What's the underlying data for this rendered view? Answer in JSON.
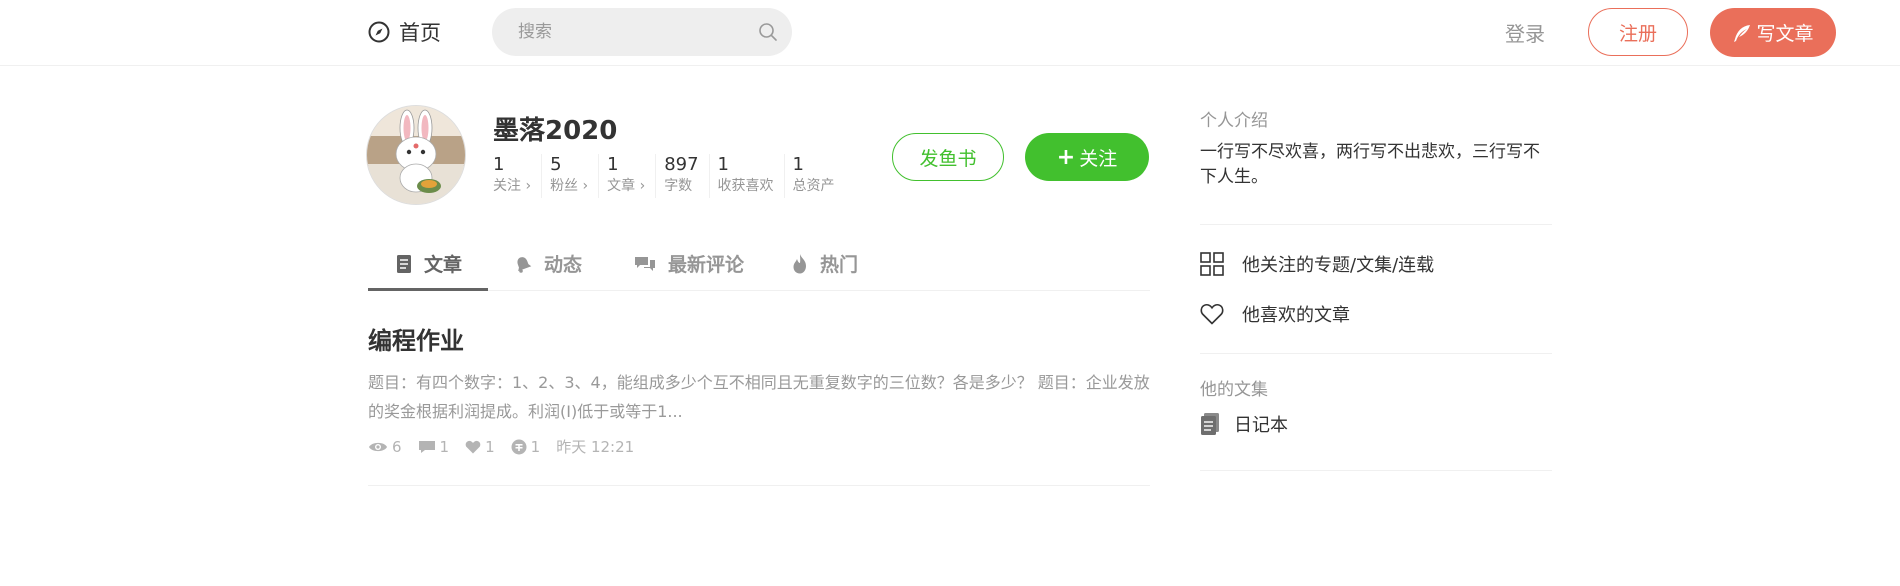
{
  "header": {
    "home_label": "首页",
    "search_placeholder": "搜索",
    "login_label": "登录",
    "register_label": "注册",
    "write_label": "写文章"
  },
  "profile": {
    "username": "墨落2020",
    "stats": [
      {
        "num": "1",
        "label": "关注 ›"
      },
      {
        "num": "5",
        "label": "粉丝 ›"
      },
      {
        "num": "1",
        "label": "文章 ›"
      },
      {
        "num": "897",
        "label": "字数"
      },
      {
        "num": "1",
        "label": "收获喜欢"
      },
      {
        "num": "1",
        "label": "总资产"
      }
    ],
    "fish_label": "发鱼书",
    "follow_label": "关注"
  },
  "tabs": [
    {
      "label": "文章",
      "icon": "article-icon",
      "active": true
    },
    {
      "label": "动态",
      "icon": "bell-icon",
      "active": false
    },
    {
      "label": "最新评论",
      "icon": "comments-icon",
      "active": false
    },
    {
      "label": "热门",
      "icon": "fire-icon",
      "active": false
    }
  ],
  "article": {
    "title": "编程作业",
    "abstract": "题目：有四个数字：1、2、3、4，能组成多少个互不相同且无重复数字的三位数？各是多少？ 题目：企业发放的奖金根据利润提成。利润(I)低于或等于1...",
    "views": "6",
    "comments": "1",
    "likes": "1",
    "rewards": "1",
    "time": "昨天 12:21"
  },
  "sidebar": {
    "intro_title": "个人介绍",
    "intro_text": "一行写不尽欢喜，两行写不出悲欢，三行写不下人生。",
    "subscriptions_label": "他关注的专题/文集/连载",
    "liked_label": "他喜欢的文章",
    "collections_title": "他的文集",
    "collection_item": "日记本"
  },
  "colors": {
    "accent_red": "#ea6f5a",
    "accent_green": "#42c02e"
  }
}
